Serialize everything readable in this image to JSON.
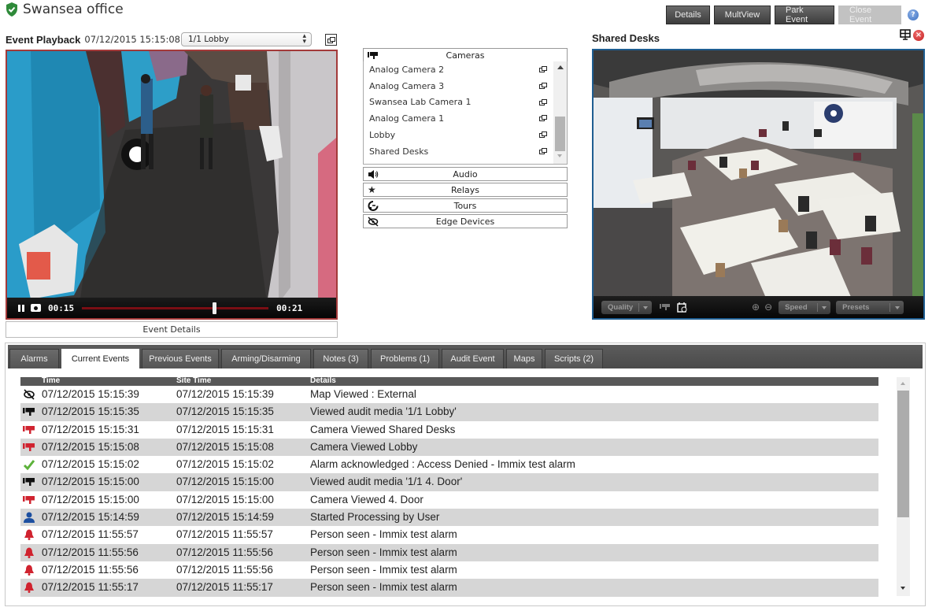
{
  "header": {
    "site_name": "Swansea office",
    "buttons": [
      {
        "label": "Details",
        "enabled": true
      },
      {
        "label": "MultView",
        "enabled": true
      },
      {
        "label": "Park Event",
        "enabled": true
      },
      {
        "label": "Close Event",
        "enabled": false
      }
    ],
    "help_icon": "?"
  },
  "playback": {
    "title": "Event Playback",
    "timestamp": "07/12/2015 15:15:08",
    "camera_select": {
      "selected": "1/1 Lobby"
    },
    "current_time": "00:15",
    "total_time": "00:21",
    "progress": 0.71,
    "event_details_label": "Event Details",
    "border_color": "#a33a3a"
  },
  "devices": {
    "cameras_label": "Cameras",
    "cameras": [
      "Analog Camera 2",
      "Analog Camera 3",
      "Swansea Lab Camera 1",
      "Analog Camera 1",
      "Lobby",
      "Shared Desks"
    ],
    "sections": [
      {
        "label": "Audio",
        "icon": "speaker-icon"
      },
      {
        "label": "Relays",
        "icon": "star-icon"
      },
      {
        "label": "Tours",
        "icon": "tour-icon"
      },
      {
        "label": "Edge Devices",
        "icon": "edge-device-icon"
      }
    ]
  },
  "live": {
    "title": "Shared Desks",
    "border_color": "#1e5d91",
    "quality_label": "Quality",
    "speed_label": "Speed",
    "presets_label": "Presets",
    "close_icon": "×"
  },
  "tabs": [
    {
      "label": "Alarms",
      "active": false
    },
    {
      "label": "Current Events",
      "active": true
    },
    {
      "label": "Previous Events",
      "active": false
    },
    {
      "label": "Arming/Disarming",
      "active": false
    },
    {
      "label": "Notes (3)",
      "active": false
    },
    {
      "label": "Problems (1)",
      "active": false
    },
    {
      "label": "Audit Event",
      "active": false
    },
    {
      "label": "Maps",
      "active": false
    },
    {
      "label": "Scripts (2)",
      "active": false
    }
  ],
  "events": {
    "columns": [
      "Time",
      "Site Time",
      "Details"
    ],
    "rows": [
      {
        "icon": "map-icon",
        "time": "07/12/2015 15:15:39",
        "site_time": "07/12/2015 15:15:39",
        "details": "Map Viewed : External"
      },
      {
        "icon": "camera-black-icon",
        "time": "07/12/2015 15:15:35",
        "site_time": "07/12/2015 15:15:35",
        "details": "Viewed audit media '1/1 Lobby'"
      },
      {
        "icon": "camera-red-icon",
        "time": "07/12/2015 15:15:31",
        "site_time": "07/12/2015 15:15:31",
        "details": "Camera Viewed Shared Desks"
      },
      {
        "icon": "camera-red-icon",
        "time": "07/12/2015 15:15:08",
        "site_time": "07/12/2015 15:15:08",
        "details": "Camera Viewed Lobby"
      },
      {
        "icon": "check-icon",
        "time": "07/12/2015 15:15:02",
        "site_time": "07/12/2015 15:15:02",
        "details": "Alarm acknowledged : Access Denied - Immix test alarm"
      },
      {
        "icon": "camera-black-icon",
        "time": "07/12/2015 15:15:00",
        "site_time": "07/12/2015 15:15:00",
        "details": "Viewed audit media '1/1 4. Door'"
      },
      {
        "icon": "camera-red-icon",
        "time": "07/12/2015 15:15:00",
        "site_time": "07/12/2015 15:15:00",
        "details": "Camera Viewed 4. Door"
      },
      {
        "icon": "user-icon",
        "time": "07/12/2015 15:14:59",
        "site_time": "07/12/2015 15:14:59",
        "details": "Started Processing by User"
      },
      {
        "icon": "bell-icon",
        "time": "07/12/2015 11:55:57",
        "site_time": "07/12/2015 11:55:57",
        "details": "Person seen - Immix test alarm"
      },
      {
        "icon": "bell-icon",
        "time": "07/12/2015 11:55:56",
        "site_time": "07/12/2015 11:55:56",
        "details": "Person seen - Immix test alarm"
      },
      {
        "icon": "bell-icon",
        "time": "07/12/2015 11:55:56",
        "site_time": "07/12/2015 11:55:56",
        "details": "Person seen - Immix test alarm"
      },
      {
        "icon": "bell-icon",
        "time": "07/12/2015 11:55:17",
        "site_time": "07/12/2015 11:55:17",
        "details": "Person seen - Immix test alarm"
      }
    ]
  }
}
